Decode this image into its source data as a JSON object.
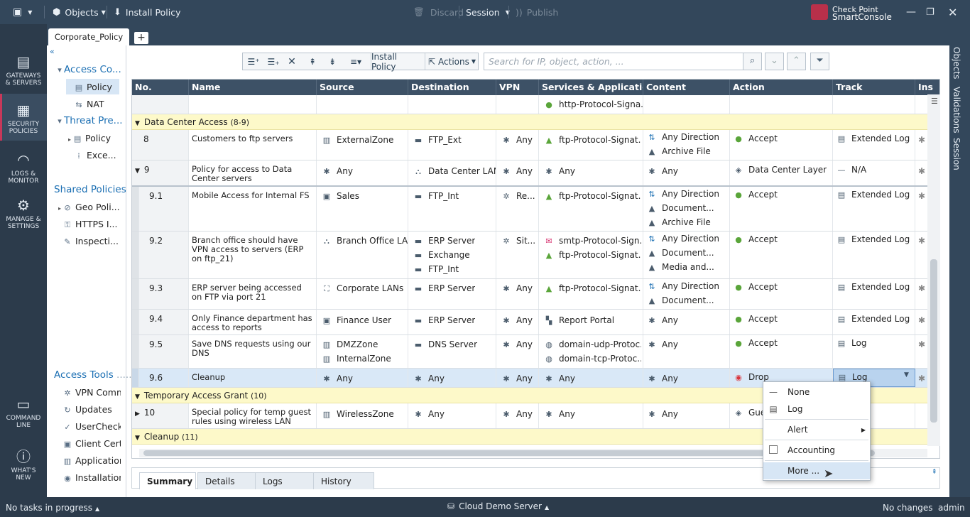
{
  "topbar": {
    "objects": "Objects",
    "install_policy": "Install Policy",
    "discard": "Discard",
    "session": "Session",
    "publish": "Publish",
    "brand_line1": "Check Point",
    "brand_line2": "SmartConsole"
  },
  "tabs": {
    "policy_tab": "Corporate_Policy",
    "add": "+"
  },
  "nav": {
    "gateways": [
      "GATEWAYS",
      "& SERVERS"
    ],
    "security": [
      "SECURITY",
      "POLICIES"
    ],
    "logs": [
      "LOGS &",
      "MONITOR"
    ],
    "manage": [
      "MANAGE &",
      "SETTINGS"
    ],
    "command": [
      "COMMAND",
      "LINE"
    ],
    "whatsnew": [
      "WHAT'S",
      "NEW"
    ]
  },
  "tree": {
    "access_control": "Access Co...",
    "policy": "Policy",
    "nat": "NAT",
    "threat_prevention": "Threat Pre...",
    "tp_policy": "Policy",
    "tp_exceptions": "Exce...",
    "shared_policies": "Shared Policies",
    "geo": "Geo Poli...",
    "https": "HTTPS I...",
    "inspection": "Inspecti...",
    "access_tools": "Access Tools",
    "vpn": "VPN Comm",
    "updates": "Updates",
    "usercheck": "UserCheck",
    "client_cert": "Client Certi",
    "application": "Applicatior",
    "installation": "Installation"
  },
  "toolbar": {
    "install_policy": "Install Policy",
    "actions": "Actions",
    "search_placeholder": "Search for IP, object, action, ..."
  },
  "columns": [
    "No.",
    "Name",
    "Source",
    "Destination",
    "VPN",
    "Services & Applications",
    "Content",
    "Action",
    "Track",
    "Ins"
  ],
  "top_partial": {
    "service": "http-Protocol-Signa..."
  },
  "sections": {
    "dca": "Data Center Access",
    "dca_range": "(8-9)",
    "tag": "Temporary Access Grant",
    "tag_range": "(10)",
    "cleanup": "Cleanup",
    "cleanup_range": "(11)"
  },
  "rules": {
    "r8": {
      "no": "8",
      "name": "Customers to ftp servers",
      "src": "ExternalZone",
      "dst": "FTP_Ext",
      "vpn": "Any",
      "svc": "ftp-Protocol-Signat...",
      "content": [
        "Any Direction",
        "Archive File"
      ],
      "action": "Accept",
      "track": "Extended Log"
    },
    "r9": {
      "no": "9",
      "name": "Policy for access to Data Center servers",
      "src": "Any",
      "dst": "Data Center LAN",
      "vpn": "Any",
      "svc": "Any",
      "content": [
        "Any"
      ],
      "action": "Data Center Layer",
      "track": "N/A"
    },
    "r91": {
      "no": "9.1",
      "name": "Mobile Access for Internal FS",
      "src": "Sales",
      "dst": "FTP_Int",
      "vpn": "Re...",
      "svc": "ftp-Protocol-Signat...",
      "content": [
        "Any Direction",
        "Document...",
        "Archive File"
      ],
      "action": "Accept",
      "track": "Extended Log"
    },
    "r92": {
      "no": "9.2",
      "name": "Branch office should have VPN access to servers  (ERP on ftp_21)",
      "src": "Branch Office LAN",
      "dst": [
        "ERP Server",
        "Exchange",
        "FTP_Int"
      ],
      "vpn": "Sit...",
      "svc": [
        "smtp-Protocol-Sign...",
        "ftp-Protocol-Signat..."
      ],
      "content": [
        "Any Direction",
        "Document...",
        "Media and..."
      ],
      "action": "Accept",
      "track": "Extended Log"
    },
    "r93": {
      "no": "9.3",
      "name": "ERP server being accessed on FTP via port 21",
      "src": "Corporate LANs",
      "dst": "ERP Server",
      "vpn": "Any",
      "svc": "ftp-Protocol-Signat...",
      "content": [
        "Any Direction",
        "Document..."
      ],
      "action": "Accept",
      "track": "Extended Log"
    },
    "r94": {
      "no": "9.4",
      "name": "Only Finance department has access to reports",
      "src": "Finance User",
      "dst": "ERP Server",
      "vpn": "Any",
      "svc": "Report Portal",
      "content": [
        "Any"
      ],
      "action": "Accept",
      "track": "Extended Log"
    },
    "r95": {
      "no": "9.5",
      "name": "Save DNS requests using our DNS",
      "src": [
        "DMZZone",
        "InternalZone"
      ],
      "dst": "DNS Server",
      "vpn": "Any",
      "svc": [
        "domain-udp-Protoc...",
        "domain-tcp-Protoc..."
      ],
      "content": [
        "Any"
      ],
      "action": "Accept",
      "track": "Log"
    },
    "r96": {
      "no": "9.6",
      "name": "Cleanup",
      "src": "Any",
      "dst": "Any",
      "vpn": "Any",
      "svc": "Any",
      "content": [
        "Any"
      ],
      "action": "Drop",
      "track": "Log"
    },
    "r10": {
      "no": "10",
      "name": "Special policy for temp guest rules using wireless LAN",
      "src": "WirelessZone",
      "dst": "Any",
      "vpn": "Any",
      "svc": "Any",
      "content": [
        "Any"
      ],
      "action": "Gue"
    }
  },
  "menu": {
    "none": "None",
    "log": "Log",
    "alert": "Alert",
    "accounting": "Accounting",
    "more": "More ..."
  },
  "bottom_tabs": [
    "Summary",
    "Details",
    "Logs",
    "History"
  ],
  "right_tabs": [
    "Objects",
    "Validations",
    "Session"
  ],
  "status": {
    "tasks": "No tasks in progress",
    "server": "Cloud Demo Server",
    "changes": "No changes",
    "user": "admin"
  },
  "colors": {
    "topbar": "#33475b",
    "header": "#3d5166",
    "section": "#fdf9c9",
    "selected": "#d9e8f7",
    "accept": "#5aa53a",
    "drop": "#d9363e",
    "link": "#1b6fb3"
  }
}
